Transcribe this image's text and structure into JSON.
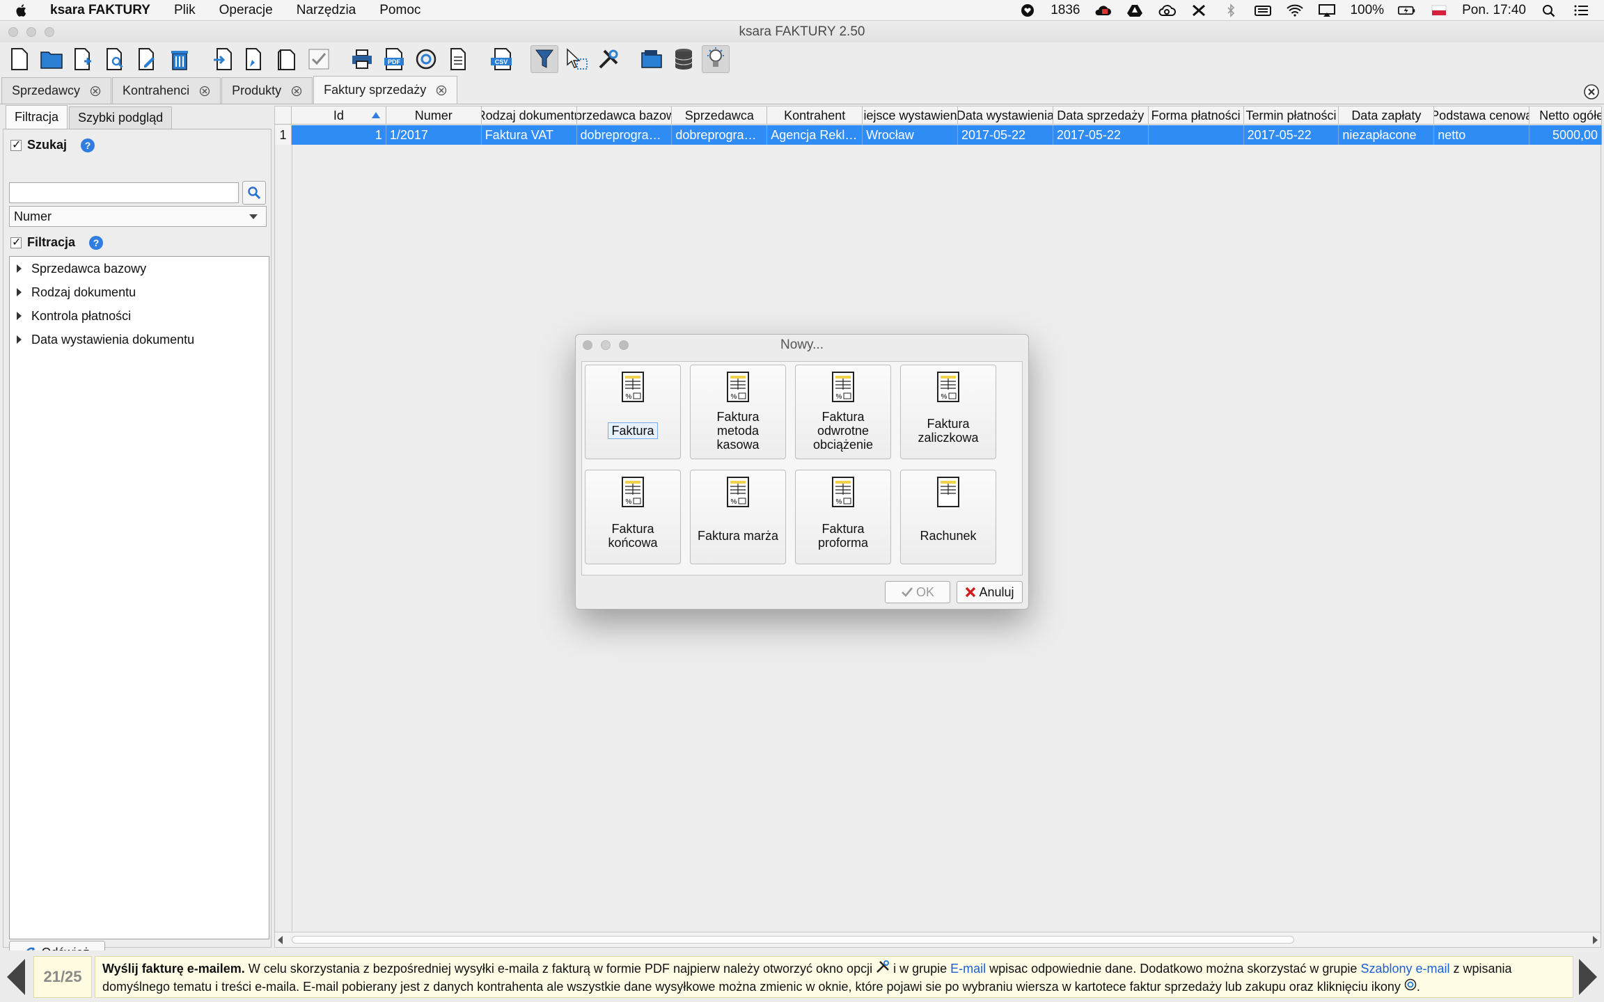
{
  "menubar": {
    "app_name": "ksara FAKTURY",
    "items": [
      "Plik",
      "Operacje",
      "Narzędzia",
      "Pomoc"
    ],
    "counter": "1836",
    "battery": "100%",
    "clock": "Pon. 17:40"
  },
  "window": {
    "title": "ksara FAKTURY 2.50"
  },
  "tabs": [
    {
      "label": "Sprzedawcy"
    },
    {
      "label": "Kontrahenci"
    },
    {
      "label": "Produkty"
    },
    {
      "label": "Faktury sprzedaży"
    }
  ],
  "left": {
    "subtabs": [
      "Filtracja",
      "Szybki podgląd"
    ],
    "search_label": "Szukaj",
    "search_value": "",
    "search_field": "Numer",
    "filter_label": "Filtracja",
    "tree": [
      "Sprzedawca bazowy",
      "Rodzaj dokumentu",
      "Kontrola płatności",
      "Data wystawienia dokumentu"
    ],
    "refresh_label": "Odśwież"
  },
  "table": {
    "columns": [
      "Id",
      "Numer",
      "Rodzaj dokumentu",
      "Sprzedawca bazowy",
      "Sprzedawca",
      "Kontrahent",
      "Miejsce wystawienia",
      "Data wystawienia",
      "Data sprzedaży",
      "Forma płatności",
      "Termin płatności",
      "Data zapłaty",
      "Podstawa cenowa",
      "Netto ogółem"
    ],
    "rows": [
      {
        "row": "1",
        "cells": [
          "1",
          "1/2017",
          "Faktura VAT",
          "dobreprogra…",
          "dobreprogra…",
          "Agencja Rekl…",
          "Wrocław",
          "2017-05-22",
          "2017-05-22",
          "",
          "2017-05-22",
          "niezapłacone",
          "netto",
          "5000,00"
        ]
      }
    ]
  },
  "dialog": {
    "title": "Nowy...",
    "options": [
      "Faktura",
      "Faktura metoda kasowa",
      "Faktura odwrotne obciążenie",
      "Faktura zaliczkowa",
      "Faktura końcowa",
      "Faktura marża",
      "Faktura proforma",
      "Rachunek"
    ],
    "ok_label": "OK",
    "cancel_label": "Anuluj"
  },
  "hint": {
    "counter": "21/25",
    "title": "Wyślij fakturę e-mailem.",
    "part1": " W celu skorzystania z bezpośredniej wysyłki e-maila z fakturą w formie PDF najpierw należy otworzyć okno opcji ",
    "part2": " i w grupie ",
    "link1": "E-mail",
    "part3": " wpisac odpowiednie dane. Dodatkowo można skorzystać w grupie ",
    "link2": "Szablony e-mail",
    "part4": " z wpisania domyślnego tematu i treści e-maila. E-mail pobierany jest z danych kontrahenta ale wszystkie dane wysyłkowe można zmienic w oknie, które pojawi sie po wybraniu wiersza w kartotece faktur sprzedaży lub zakupu oraz kliknięciu ikony ",
    "part5": "."
  }
}
